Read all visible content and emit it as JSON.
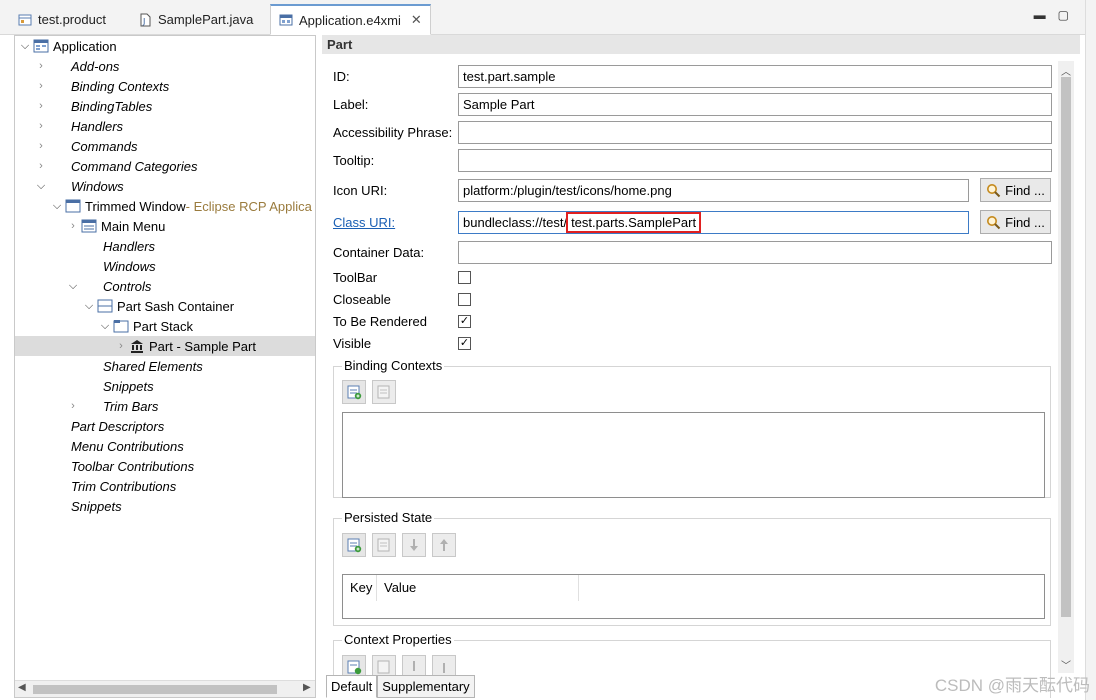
{
  "tabs": [
    {
      "label": "test.product",
      "icon": "product-icon"
    },
    {
      "label": "SamplePart.java",
      "icon": "java-file-icon"
    },
    {
      "label": "Application.e4xmi",
      "icon": "e4xmi-icon",
      "active": true,
      "close": "✕"
    }
  ],
  "window_buttons": {
    "minimize": "▬",
    "maximize": "▢"
  },
  "tree": {
    "application": "Application",
    "addons": "Add-ons",
    "binding_contexts": "Binding Contexts",
    "binding_tables": "BindingTables",
    "handlers": "Handlers",
    "commands": "Commands",
    "command_categories": "Command Categories",
    "windows": "Windows",
    "trimmed_window": "Trimmed Window",
    "trimmed_window_suffix": " - Eclipse RCP Applica",
    "main_menu": "Main Menu",
    "win_handlers": "Handlers",
    "win_windows": "Windows",
    "controls": "Controls",
    "part_sash_container": "Part Sash Container",
    "part_stack": "Part Stack",
    "part_sample": "Part - Sample Part",
    "shared_elements": "Shared Elements",
    "snippets_inner": "Snippets",
    "trim_bars": "Trim Bars",
    "part_descriptors": "Part Descriptors",
    "menu_contributions": "Menu Contributions",
    "toolbar_contributions": "Toolbar Contributions",
    "trim_contributions": "Trim Contributions",
    "snippets": "Snippets"
  },
  "part": {
    "header": "Part",
    "id_label": "ID:",
    "id_value": "test.part.sample",
    "label_label": "Label:",
    "label_value": "Sample Part",
    "accessibility_label": "Accessibility Phrase:",
    "accessibility_value": "",
    "tooltip_label": "Tooltip:",
    "tooltip_value": "",
    "icon_uri_label": "Icon URI:",
    "icon_uri_value": "platform:/plugin/test/icons/home.png",
    "class_uri_label": "Class URI:",
    "class_uri_prefix": "bundleclass://test/",
    "class_uri_highlight": "test.parts.SamplePart",
    "container_data_label": "Container Data:",
    "container_data_value": "",
    "find_label": "Find ...",
    "toolbar_label": "ToolBar",
    "toolbar_checked": false,
    "closeable_label": "Closeable",
    "closeable_checked": false,
    "to_be_rendered_label": "To Be Rendered",
    "to_be_rendered_checked": true,
    "visible_label": "Visible",
    "visible_checked": true,
    "binding_contexts_title": "Binding Contexts",
    "persisted_state_title": "Persisted State",
    "key_header": "Key",
    "value_header": "Value",
    "context_properties_title": "Context Properties"
  },
  "bottom_tabs": [
    "Default",
    "Supplementary"
  ],
  "watermark": "CSDN @雨天酝代码",
  "colors": {
    "highlight_border": "#e02020",
    "link": "#1a5fb4",
    "selected_row": "#dcdcdc"
  }
}
